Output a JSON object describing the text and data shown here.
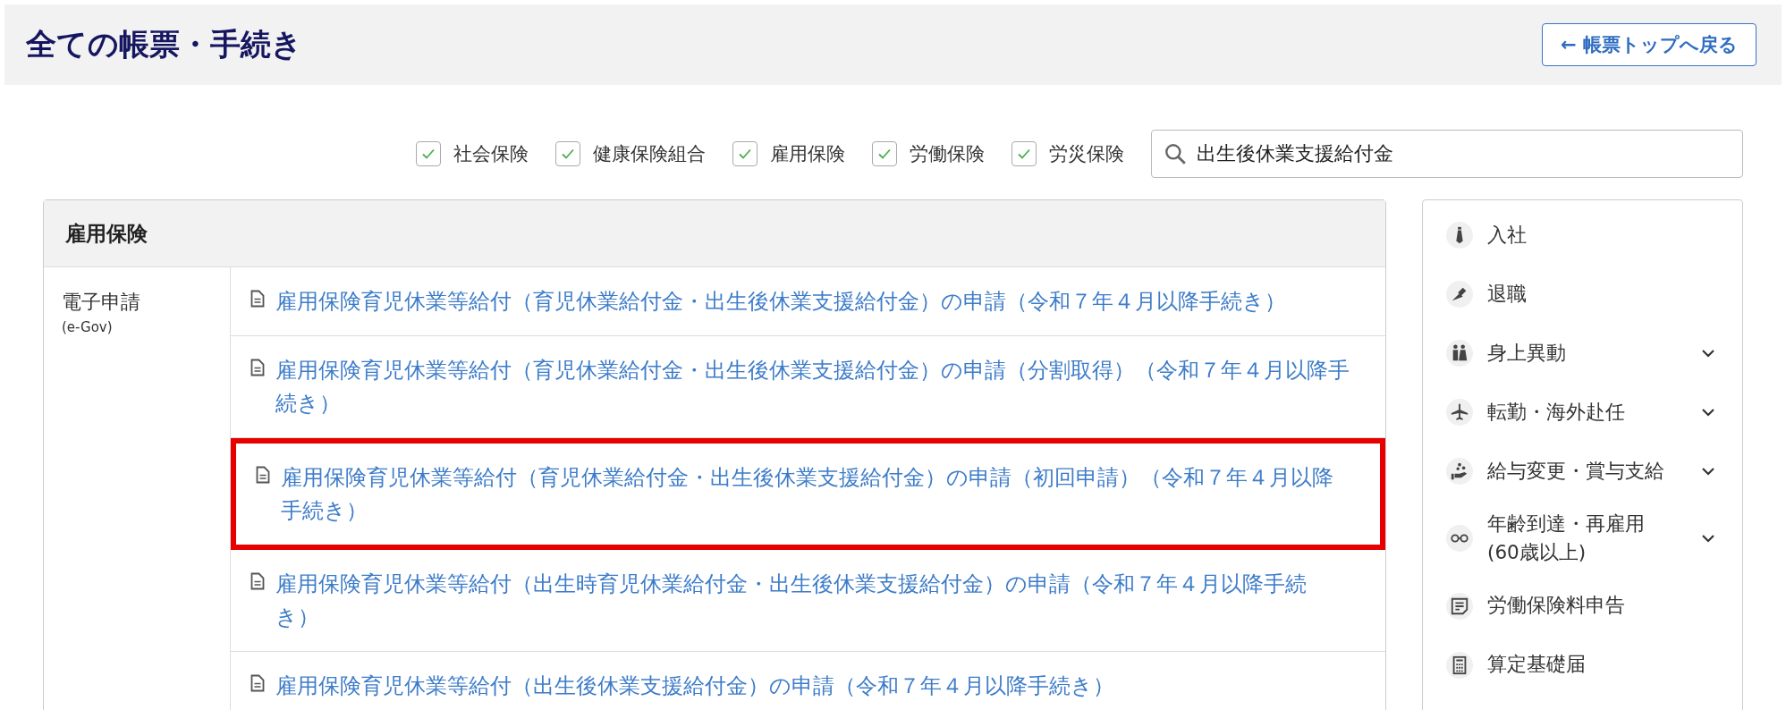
{
  "header": {
    "title": "全ての帳票・手続き",
    "back_button": {
      "arrow": "←",
      "label": "帳票トップへ戻る"
    }
  },
  "filters": [
    {
      "label": "社会保険",
      "checked": true
    },
    {
      "label": "健康保険組合",
      "checked": true
    },
    {
      "label": "雇用保険",
      "checked": true
    },
    {
      "label": "労働保険",
      "checked": true
    },
    {
      "label": "労災保険",
      "checked": true
    }
  ],
  "search": {
    "value": "出生後休業支援給付金"
  },
  "section": {
    "title": "雇用保険",
    "category": {
      "name": "電子申請",
      "sub": "(e-Gov)"
    },
    "rows": [
      {
        "text": "雇用保険育児休業等給付（育児休業給付金・出生後休業支援給付金）の申請（令和７年４月以降手続き）",
        "highlighted": false
      },
      {
        "text": "雇用保険育児休業等給付（育児休業給付金・出生後休業支援給付金）の申請（分割取得）（令和７年４月以降手続き）",
        "highlighted": false
      },
      {
        "text": "雇用保険育児休業等給付（育児休業給付金・出生後休業支援給付金）の申請（初回申請）（令和７年４月以降手続き）",
        "highlighted": true
      },
      {
        "text": "雇用保険育児休業等給付（出生時育児休業給付金・出生後休業支援給付金）の申請（令和７年４月以降手続き）",
        "highlighted": false
      },
      {
        "text": "雇用保険育児休業等給付（出生後休業支援給付金）の申請（令和７年４月以降手続き）",
        "highlighted": false
      }
    ]
  },
  "sidebar": {
    "items": [
      {
        "label": "入社",
        "expandable": false
      },
      {
        "label": "退職",
        "expandable": false
      },
      {
        "label": "身上異動",
        "expandable": true
      },
      {
        "label": "転勤・海外赴任",
        "expandable": true
      },
      {
        "label": "給与変更・賞与支給",
        "expandable": true
      },
      {
        "label": "年齢到達・再雇用\n(60歳以上)",
        "expandable": true
      },
      {
        "label": "労働保険料申告",
        "expandable": false
      },
      {
        "label": "算定基礎届",
        "expandable": false
      }
    ]
  }
}
